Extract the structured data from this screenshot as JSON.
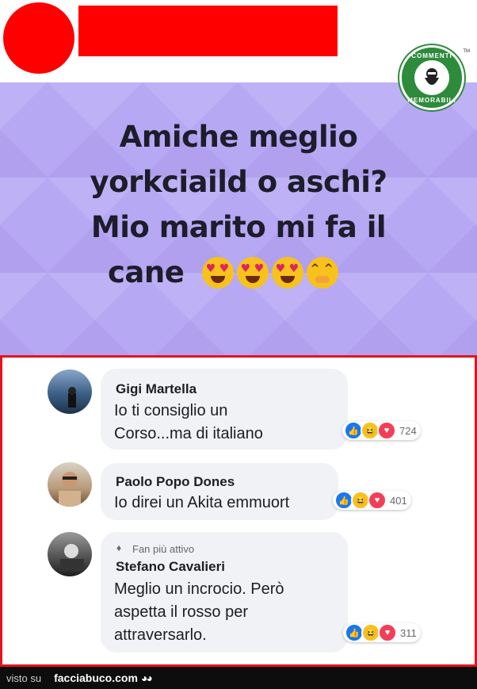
{
  "post": {
    "line1": "Amiche meglio",
    "line2": "yorkciaild o aschi?",
    "line3": "Mio marito mi fa il",
    "line4": "cane"
  },
  "logo": {
    "top_text": "COMMENTI",
    "bottom_text": "MEMORABILI",
    "tm": "TM"
  },
  "comments": [
    {
      "name": "Gigi Martella",
      "text_line1": "Io ti consiglio un",
      "text_line2": "Corso...ma di italiano",
      "reaction_count": "724"
    },
    {
      "name": "Paolo Popo Dones",
      "text_line1": "Io direi un Akita emmuort",
      "reaction_count": "401"
    },
    {
      "badge": "Fan più attivo",
      "name": "Stefano Cavalieri",
      "text_line1": "Meglio un incrocio. Però",
      "text_line2": "aspetta il rosso per",
      "text_line3": "attraversarlo.",
      "reaction_count": "311"
    }
  ],
  "footer": {
    "visto": "visto su",
    "site": "facciabuco.com"
  },
  "colors": {
    "post_bg": "#b7a8f4",
    "highlight": "#e3141c",
    "redaction": "#ff0000",
    "logo_green": "#2e8b3c"
  }
}
